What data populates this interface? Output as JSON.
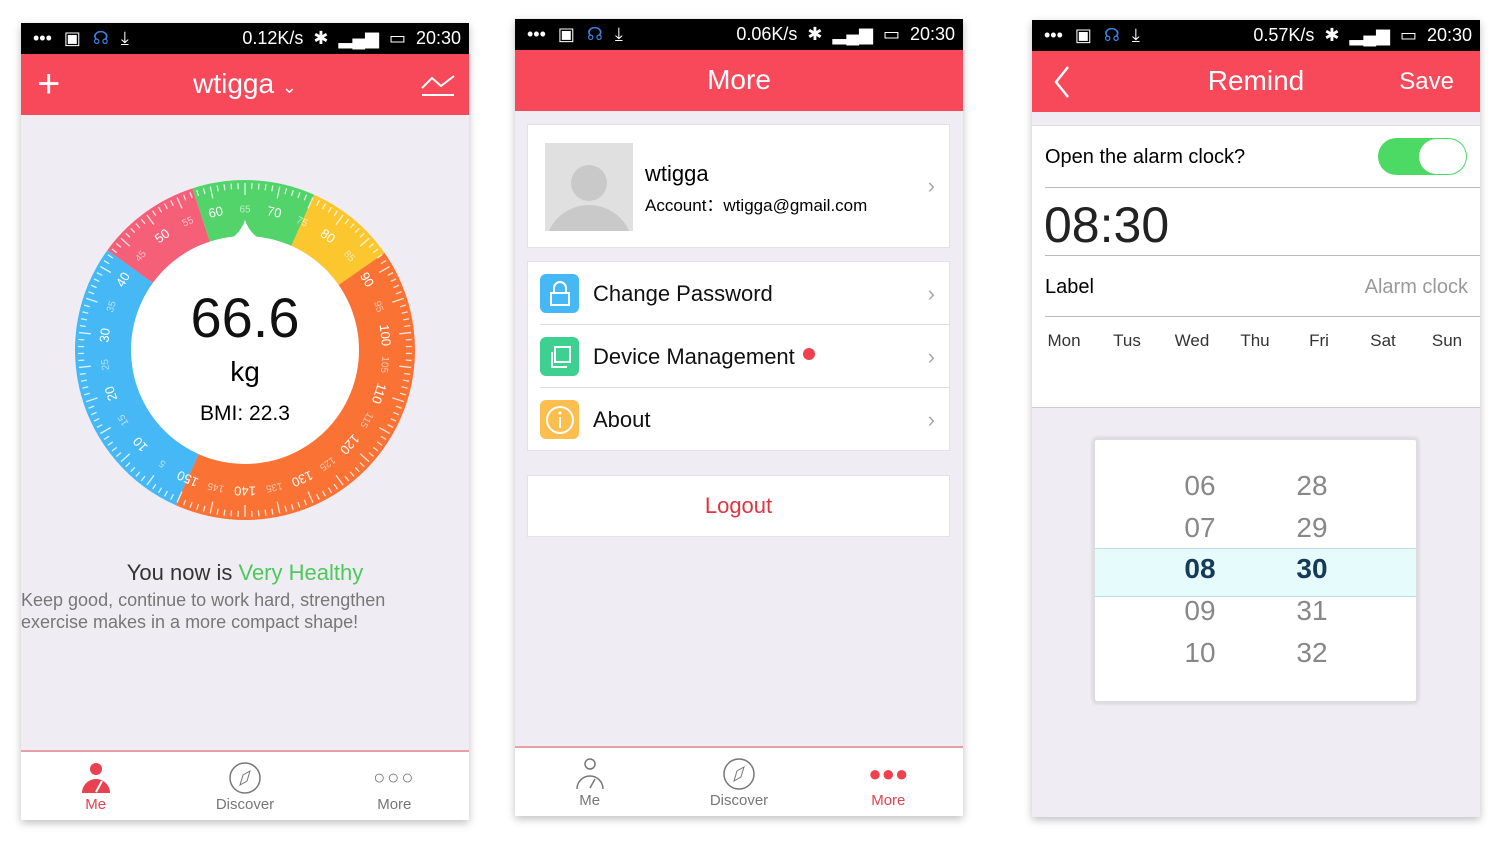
{
  "phone1": {
    "status": {
      "speed": "0.12K/s",
      "time": "20:30"
    },
    "header": {
      "title": "wtigga"
    },
    "gauge": {
      "value": "66.6",
      "unit": "kg",
      "bmi": "BMI: 22.3",
      "min": 0,
      "max": 150,
      "segments": [
        {
          "from": 0,
          "to": 42.5,
          "color": "#45b8f5"
        },
        {
          "from": 42.5,
          "to": 57.5,
          "color": "#f55f78"
        },
        {
          "from": 57.5,
          "to": 75,
          "color": "#52d46a"
        },
        {
          "from": 75,
          "to": 88,
          "color": "#fcc62e"
        },
        {
          "from": 88,
          "to": 150,
          "color": "#fb7235"
        }
      ],
      "major_labels": [
        "10",
        "20",
        "30",
        "40",
        "50",
        "60",
        "70",
        "80",
        "90",
        "100",
        "110",
        "120",
        "130",
        "140",
        "150"
      ],
      "minor_labels": [
        "5",
        "15",
        "25",
        "35",
        "45",
        "55",
        "65",
        "75",
        "85",
        "95",
        "105",
        "115",
        "125",
        "135",
        "145"
      ]
    },
    "status_prefix": "You now is ",
    "status_word": "Very Healthy",
    "status_color": "#4cc95a",
    "advice": "Keep good, continue to work hard, strengthen exercise makes in a more compact shape!",
    "nav": [
      "Me",
      "Discover",
      "More"
    ]
  },
  "phone2": {
    "status": {
      "speed": "0.06K/s",
      "time": "20:30"
    },
    "header": {
      "title": "More"
    },
    "profile": {
      "name": "wtigga",
      "account": "Account：wtigga@gmail.com"
    },
    "menu": [
      {
        "label": "Change Password",
        "icon": "lock-icon",
        "color": "#45b8f5"
      },
      {
        "label": "Device Management",
        "icon": "devices-icon",
        "color": "#3dd090"
      },
      {
        "label": "About",
        "icon": "info-icon",
        "color": "#fbbe4f"
      }
    ],
    "logout": "Logout",
    "nav": [
      "Me",
      "Discover",
      "More"
    ]
  },
  "phone3": {
    "status": {
      "speed": "0.57K/s",
      "time": "20:30"
    },
    "header": {
      "title": "Remind",
      "save": "Save"
    },
    "alarm_question": "Open the alarm clock?",
    "alarm_on": true,
    "time": "08:30",
    "label": "Label",
    "label_value": "Alarm clock",
    "days": [
      "Mon",
      "Tus",
      "Wed",
      "Thu",
      "Fri",
      "Sat",
      "Sun"
    ],
    "hours": [
      "06",
      "07",
      "08",
      "09",
      "10"
    ],
    "minutes": [
      "28",
      "29",
      "30",
      "31",
      "32"
    ]
  }
}
